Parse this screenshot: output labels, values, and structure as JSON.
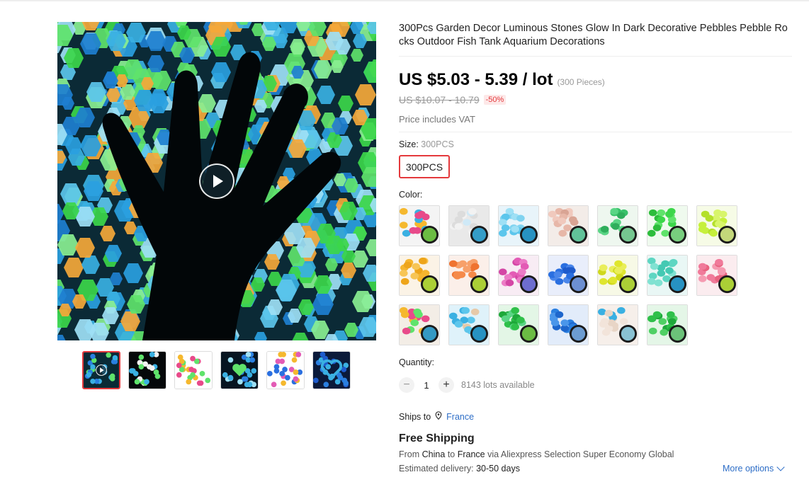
{
  "product": {
    "title": "300Pcs Garden Decor Luminous Stones Glow In Dark Decorative Pebbles Pebble Rocks Outdoor Fish Tank Aquarium Decorations",
    "price": "US $5.03 - 5.39 / lot",
    "price_unit": "(300 Pieces)",
    "original_price": "US $10.07 - 10.79",
    "discount": "-50%",
    "vat_note": "Price includes VAT"
  },
  "gallery": {
    "main_icon": "play-icon",
    "thumbnails": [
      {
        "name": "thumb-1",
        "active": true
      },
      {
        "name": "thumb-2",
        "active": false
      },
      {
        "name": "thumb-3",
        "active": false
      },
      {
        "name": "thumb-4",
        "active": false
      },
      {
        "name": "thumb-5",
        "active": false
      },
      {
        "name": "thumb-6",
        "active": false
      }
    ]
  },
  "size": {
    "label": "Size:",
    "selected": "300PCS",
    "options": [
      "300PCS"
    ]
  },
  "color": {
    "label": "Color:",
    "swatches": [
      {
        "bg": "#f4f4f4",
        "fg": [
          "#e84a8a",
          "#f5b82e",
          "#3ab0e2",
          "#7ad94b"
        ]
      },
      {
        "bg": "#e9e9e9",
        "fg": [
          "#f2f2f2",
          "#dcdcdc",
          "#cfe9f7",
          "#39b5e8"
        ]
      },
      {
        "bg": "#e8f4fa",
        "fg": [
          "#7fd3f0",
          "#5cc6ec",
          "#9ee0f5",
          "#2aa8e0"
        ]
      },
      {
        "bg": "#f3ece8",
        "fg": [
          "#e7b7a8",
          "#f0c9bd",
          "#d9a494",
          "#6fe0b0"
        ]
      },
      {
        "bg": "#eef7ef",
        "fg": [
          "#39c26a",
          "#5ad585",
          "#2fae5c",
          "#86e6a6"
        ]
      },
      {
        "bg": "#effaee",
        "fg": [
          "#3cd64a",
          "#5fe36b",
          "#2dbd3c",
          "#8aef91"
        ]
      },
      {
        "bg": "#f6fbe6",
        "fg": [
          "#c6f03c",
          "#d8f56a",
          "#b3e02a",
          "#e2f98c"
        ]
      },
      {
        "bg": "#fbf3e6",
        "fg": [
          "#f5b52e",
          "#f7c555",
          "#eea51a",
          "#c6f03c"
        ]
      },
      {
        "bg": "#fbefe9",
        "fg": [
          "#f58a4a",
          "#f7a06a",
          "#ef7330",
          "#c6f03c"
        ]
      },
      {
        "bg": "#f8ecf4",
        "fg": [
          "#e35bb5",
          "#ec7cc6",
          "#d446a5",
          "#7c7cf0"
        ]
      },
      {
        "bg": "#e9eefb",
        "fg": [
          "#2a6fe0",
          "#4a86ea",
          "#1e5bcc",
          "#7ba4f2"
        ]
      },
      {
        "bg": "#f7f9e6",
        "fg": [
          "#dfe62e",
          "#e9ee5a",
          "#cfd81c",
          "#c6f03c"
        ]
      },
      {
        "bg": "#e9f7f5",
        "fg": [
          "#5ed6c2",
          "#80e2d2",
          "#44c9b3",
          "#2aa8e0"
        ]
      },
      {
        "bg": "#fbecef",
        "fg": [
          "#f07a9a",
          "#f59ab1",
          "#e8627f",
          "#c6f03c"
        ]
      },
      {
        "bg": "#f3ede6",
        "fg": [
          "#e84a8a",
          "#5fe36b",
          "#f5b82e",
          "#3ab0e2"
        ]
      },
      {
        "bg": "#dff2fa",
        "fg": [
          "#3ab0e2",
          "#5cc6ec",
          "#e6c9a8",
          "#2aa8e0"
        ]
      },
      {
        "bg": "#e3f6e6",
        "fg": [
          "#2fc04a",
          "#5ad585",
          "#1ea83a",
          "#7ad94b"
        ]
      },
      {
        "bg": "#e2ecfa",
        "fg": [
          "#2a7fe0",
          "#4a96ea",
          "#1e66cc",
          "#7bb4f2"
        ]
      },
      {
        "bg": "#f6efea",
        "fg": [
          "#f2e4da",
          "#e8d5c6",
          "#3ab0e2",
          "#9ee0f5"
        ]
      },
      {
        "bg": "#e4f6e7",
        "fg": [
          "#2fc04a",
          "#4fd064",
          "#1ea83a",
          "#7ae08b"
        ]
      }
    ]
  },
  "quantity": {
    "label": "Quantity:",
    "minus": "−",
    "plus": "+",
    "value": "1",
    "available": "8143 lots available"
  },
  "shipping": {
    "ships_to_label": "Ships to",
    "country": "France",
    "free_shipping": "Free Shipping",
    "route_from": "From",
    "origin": "China",
    "route_to": "to",
    "destination": "France",
    "route_via": "via Aliexpress Selection Super Economy Global",
    "delivery_label": "Estimated delivery:",
    "delivery_value": "30-50 days",
    "more_options": "More options"
  }
}
